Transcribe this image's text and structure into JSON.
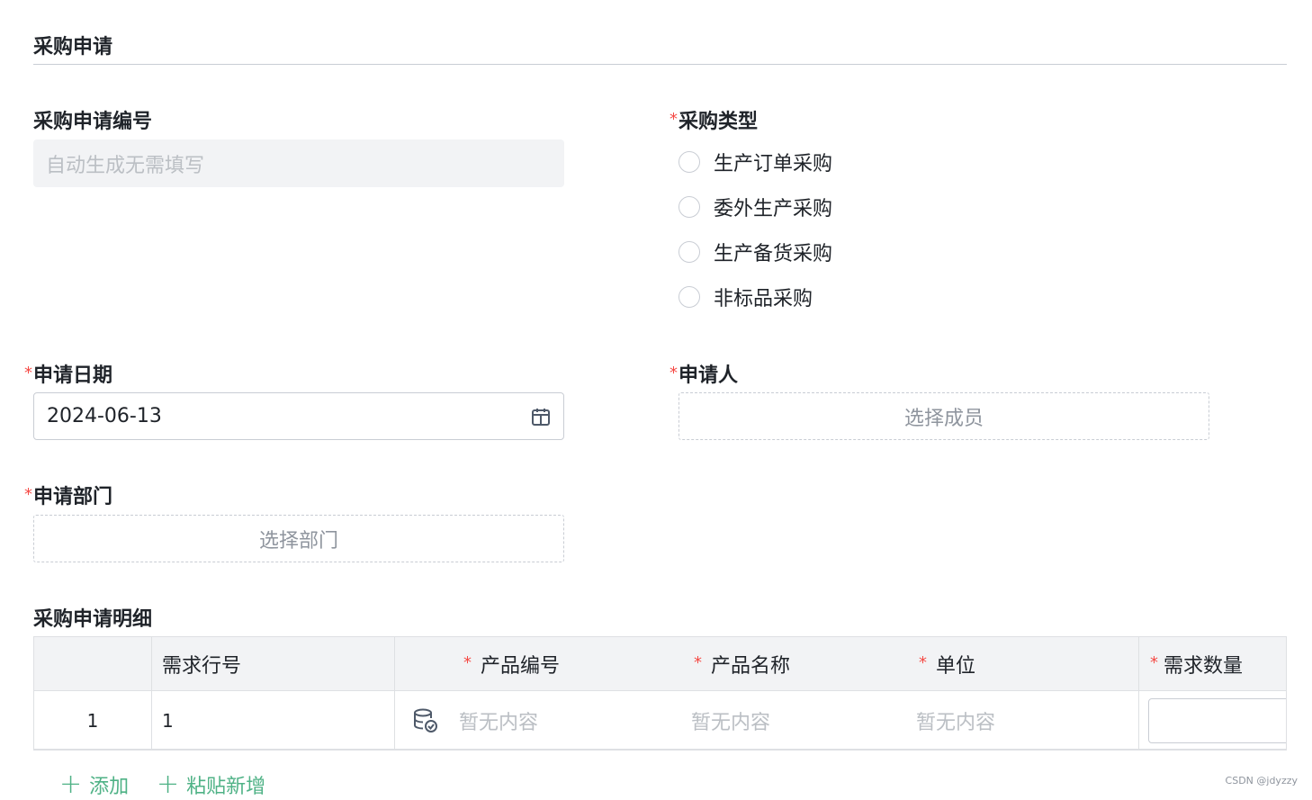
{
  "section_title": "采购申请",
  "fields": {
    "request_no": {
      "label": "采购申请编号",
      "placeholder": "自动生成无需填写"
    },
    "purchase_type": {
      "label": "采购类型",
      "required_mark": "*",
      "options": [
        "生产订单采购",
        "委外生产采购",
        "生产备货采购",
        "非标品采购"
      ]
    },
    "apply_date": {
      "label": "申请日期",
      "required_mark": "*",
      "value": "2024-06-13",
      "icon": "calendar-icon"
    },
    "applicant": {
      "label": "申请人",
      "required_mark": "*",
      "button": "选择成员"
    },
    "department": {
      "label": "申请部门",
      "required_mark": "*",
      "button": "选择部门"
    }
  },
  "detail": {
    "title": "采购申请明细",
    "columns": [
      {
        "label": "",
        "required": false
      },
      {
        "label": "需求行号",
        "required": false
      },
      {
        "label": "产品编号",
        "required": true
      },
      {
        "label": "产品名称",
        "required": true
      },
      {
        "label": "单位",
        "required": true
      },
      {
        "label": "需求数量",
        "required": true
      }
    ],
    "required_mark": "*",
    "rows": [
      {
        "index": "1",
        "line_no": "1",
        "product_code": "暂无内容",
        "product_name": "暂无内容",
        "unit": "暂无内容",
        "qty": ""
      }
    ],
    "actions": {
      "add": "添加",
      "paste_add": "粘贴新增"
    },
    "plus_symbol": "+",
    "icon": "database-check-icon"
  },
  "watermark": "CSDN @jdyzzy",
  "colors": {
    "required": "#f54a45",
    "accent": "#4fb286",
    "placeholder": "#bbbfc4",
    "border": "#c9cdd4"
  }
}
